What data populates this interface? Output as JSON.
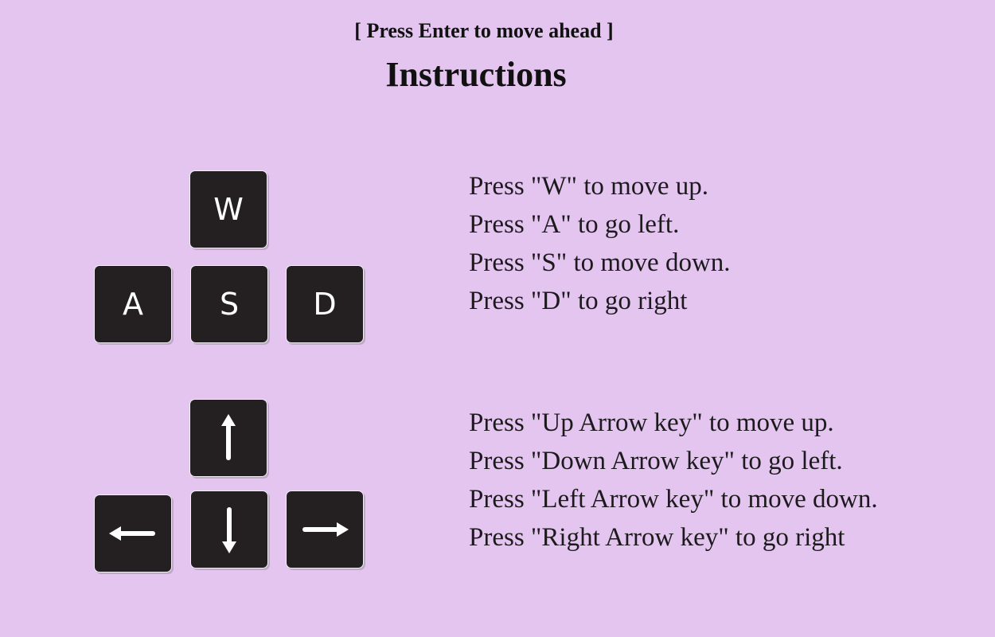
{
  "header": {
    "hint": "[ Press Enter to move ahead ]",
    "title": "Instructions"
  },
  "wasd": {
    "keys": {
      "w": "W",
      "a": "A",
      "s": "S",
      "d": "D"
    },
    "lines": [
      "Press \"W\" to move up.",
      "Press \"A\" to go left.",
      "Press \"S\" to move down.",
      "Press \"D\" to go right"
    ]
  },
  "arrows": {
    "icons": [
      "arrow-up-icon",
      "arrow-left-icon",
      "arrow-down-icon",
      "arrow-right-icon"
    ],
    "lines": [
      "Press \"Up Arrow key\" to move up.",
      "Press \"Down Arrow key\" to go left.",
      "Press \"Left Arrow key\" to move down.",
      "Press \"Right Arrow key\" to go right"
    ]
  },
  "colors": {
    "background": "#e3c5ef",
    "key": "#242022",
    "key_text": "#ffffff",
    "text": "#1c1a1c"
  }
}
